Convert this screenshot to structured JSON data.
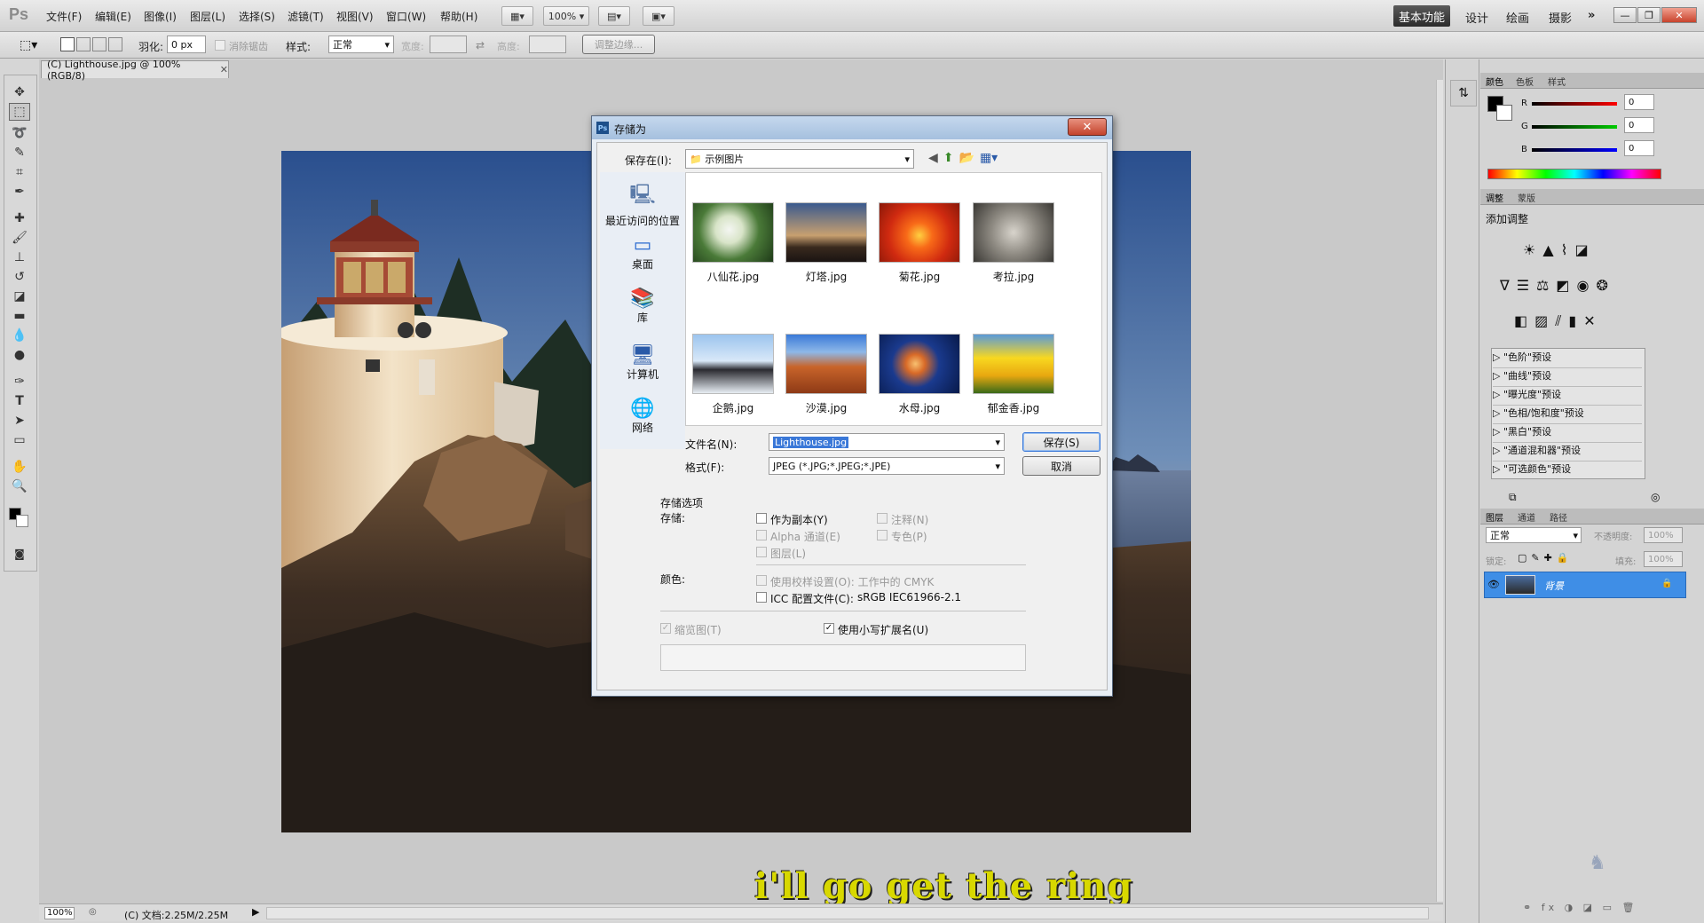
{
  "app": {
    "logo": "Ps"
  },
  "menu": [
    "文件(F)",
    "编辑(E)",
    "图像(I)",
    "图层(L)",
    "选择(S)",
    "滤镜(T)",
    "视图(V)",
    "窗口(W)",
    "帮助(H)"
  ],
  "zoom_select": "100%",
  "workspaces": {
    "active": "基本功能",
    "others": [
      "设计",
      "绘画",
      "摄影"
    ]
  },
  "options": {
    "feather_label": "羽化:",
    "feather_value": "0 px",
    "antialias_label": "消除锯齿",
    "style_label": "样式:",
    "style_value": "正常",
    "width_label": "宽度:",
    "height_label": "高度:",
    "refine_edge": "调整边缘..."
  },
  "doc_tab": {
    "title": "(C) Lighthouse.jpg @ 100%(RGB/8)"
  },
  "subtitle": "i'll go get the ring",
  "status": {
    "zoom": "100%",
    "doc": "(C) 文档:2.25M/2.25M"
  },
  "color_panel": {
    "tabs": [
      "颜色",
      "色板",
      "样式"
    ],
    "channels": [
      {
        "label": "R",
        "value": "0"
      },
      {
        "label": "G",
        "value": "0"
      },
      {
        "label": "B",
        "value": "0"
      }
    ]
  },
  "adjust_panel": {
    "tabs": [
      "调整",
      "蒙版"
    ],
    "title": "添加调整",
    "presets": [
      "\"色阶\"预设",
      "\"曲线\"预设",
      "\"曝光度\"预设",
      "\"色相/饱和度\"预设",
      "\"黑白\"预设",
      "\"通道混和器\"预设",
      "\"可选颜色\"预设"
    ]
  },
  "layers_panel": {
    "tabs": [
      "图层",
      "通道",
      "路径"
    ],
    "blend_mode": "正常",
    "opacity_label": "不透明度:",
    "opacity_value": "100%",
    "lock_label": "锁定:",
    "fill_label": "填充:",
    "fill_value": "100%",
    "layer_name": "背景"
  },
  "dialog": {
    "title": "存储为",
    "save_in_label": "保存在(I):",
    "save_in_value": "示例图片",
    "places": [
      "最近访问的位置",
      "桌面",
      "库",
      "计算机",
      "网络"
    ],
    "files": [
      "八仙花.jpg",
      "灯塔.jpg",
      "菊花.jpg",
      "考拉.jpg",
      "企鹅.jpg",
      "沙漠.jpg",
      "水母.jpg",
      "郁金香.jpg"
    ],
    "filename_label": "文件名(N):",
    "filename_value": "Lighthouse.jpg",
    "format_label": "格式(F):",
    "format_value": "JPEG (*.JPG;*.JPEG;*.JPE)",
    "save_button": "保存(S)",
    "cancel_button": "取消",
    "save_options_label": "存储选项",
    "save_label": "存储:",
    "as_copy": "作为副本(Y)",
    "notes": "注释(N)",
    "alpha": "Alpha 通道(E)",
    "spot": "专色(P)",
    "layers": "图层(L)",
    "color_label": "颜色:",
    "use_proof": "使用校样设置(O): 工作中的 CMYK",
    "icc_label": "ICC 配置文件(C):",
    "icc_value": "sRGB IEC61966-2.1",
    "thumbnail": "缩览图(T)",
    "lowercase_ext": "使用小写扩展名(U)"
  }
}
